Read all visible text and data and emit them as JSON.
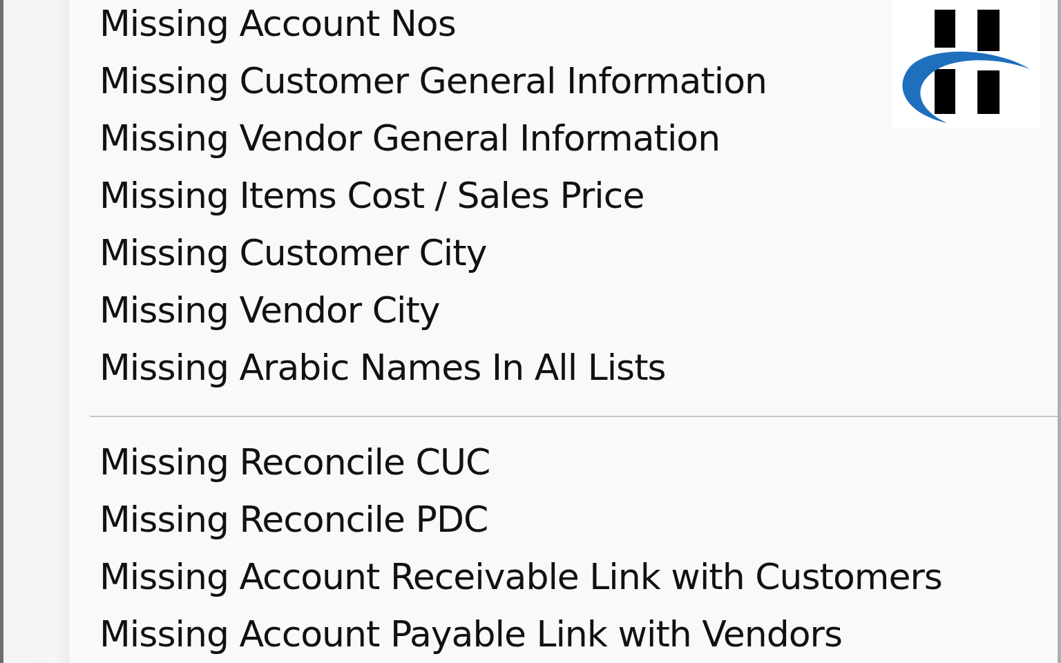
{
  "menu": {
    "groups": [
      {
        "items": [
          "Missing Account Nos",
          "Missing Customer General Information",
          "Missing Vendor General Information",
          "Missing Items Cost / Sales Price",
          "Missing Customer City",
          "Missing Vendor City",
          "Missing Arabic Names In All Lists"
        ]
      },
      {
        "items": [
          "Missing Reconcile CUC",
          "Missing Reconcile PDC",
          "Missing Account Receivable Link with Customers",
          "Missing Account Payable Link with Vendors"
        ]
      }
    ]
  }
}
